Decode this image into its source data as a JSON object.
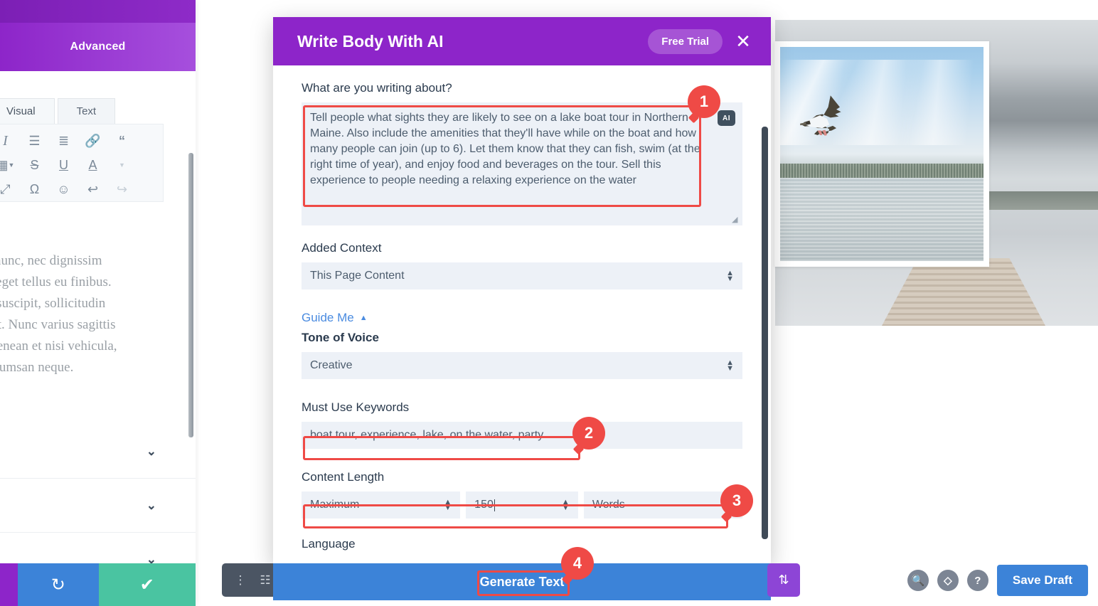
{
  "left_panel": {
    "tab_label": "Advanced",
    "editor_tabs": [
      {
        "label": "Visual",
        "active": true
      },
      {
        "label": "Text",
        "active": false
      }
    ],
    "toolbar_icons": [
      "italic-icon",
      "bulleted-list-icon",
      "numbered-list-icon",
      "link-icon",
      "blockquote-icon",
      "table-icon",
      "strikethrough-icon",
      "underline-icon",
      "text-color-icon",
      "color-dropdown-icon",
      "fullscreen-icon",
      "special-character-icon",
      "emoji-icon",
      "undo-icon",
      "redo-icon"
    ],
    "body_text_lines": [
      "t nunc, nec dignissim",
      "s eget tellus eu finibus.",
      "e suscipit, sollicitudin",
      "rat. Nunc varius sagittis",
      "Aenean et nisi vehicula,",
      "ccumsan neque."
    ],
    "collapsed_rows": [
      "",
      "",
      ""
    ],
    "bottom_actions": [
      {
        "name": "purple-tab",
        "label": ""
      },
      {
        "name": "reset-button",
        "label": "↻"
      },
      {
        "name": "save-button",
        "label": "✔"
      }
    ]
  },
  "modal": {
    "title": "Write Body With AI",
    "free_trial_label": "Free Trial",
    "close_label": "✕",
    "accent_color": "#8d25c9",
    "fields": {
      "prompt_label": "What are you writing about?",
      "prompt_value": "Tell people what sights they are likely to see on a lake boat tour in Northern Maine. Also include the amenities that they'll have while on the boat and how many people can join (up to 6). Let them know that they can fish, swim (at the right time of year), and enjoy food and beverages on the tour. Sell this experience to people needing a relaxing experience on the water",
      "ai_badge_label": "AI",
      "added_context_label": "Added Context",
      "added_context_value": "This Page Content",
      "guide_me_label": "Guide Me",
      "tone_label": "Tone of Voice",
      "tone_value": "Creative",
      "keywords_label": "Must Use Keywords",
      "keywords_value": "boat tour, experience, lake, on the water, party",
      "content_length_label": "Content Length",
      "length_mode_value": "Maximum",
      "length_number_value": "150",
      "length_unit_value": "Words",
      "language_label": "Language"
    },
    "generate_button_label": "Generate Text"
  },
  "annotations": [
    {
      "number": "1",
      "target": "prompt-textarea"
    },
    {
      "number": "2",
      "target": "keywords-input"
    },
    {
      "number": "3",
      "target": "content-length-row"
    },
    {
      "number": "4",
      "target": "generate-text-button"
    }
  ],
  "bottom_bar": {
    "left_icons": [
      "kebab-menu-icon",
      "wireframe-view-icon"
    ],
    "right_purple_icon": "sort-updown-icon",
    "right_icons": [
      "zoom-icon",
      "layers-icon",
      "help-icon"
    ],
    "save_draft_label": "Save Draft",
    "save_draft_color": "#3c83d8"
  }
}
